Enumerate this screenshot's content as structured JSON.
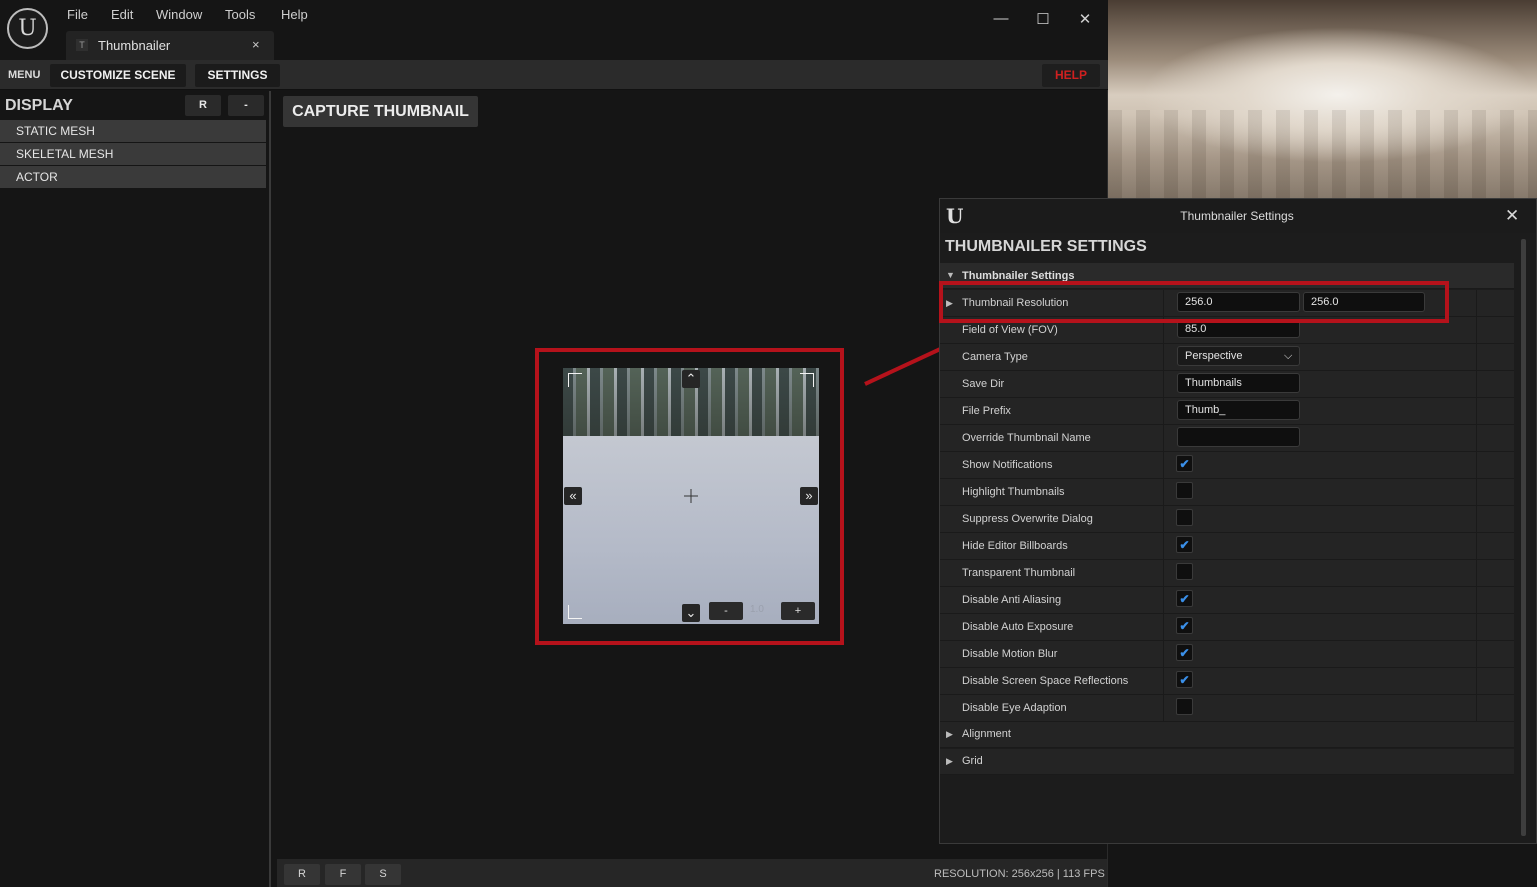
{
  "menubar": {
    "items": [
      "File",
      "Edit",
      "Window",
      "Tools",
      "Help"
    ]
  },
  "tab": {
    "label": "Thumbnailer",
    "icon_letter": "T",
    "close": "×"
  },
  "window_controls": {
    "minimize": "—",
    "maximize": "☐",
    "close": "✕"
  },
  "toolbar": {
    "menu_label": "MENU",
    "customize_scene": "CUSTOMIZE SCENE",
    "settings": "SETTINGS",
    "help": "HELP"
  },
  "left_panel": {
    "title": "DISPLAY",
    "reset_btn": "R",
    "collapse_btn": "-",
    "items": [
      "STATIC MESH",
      "SKELETAL MESH",
      "ACTOR"
    ]
  },
  "viewport": {
    "capture_button": "CAPTURE THUMBNAIL",
    "bottom_buttons": [
      "R",
      "F",
      "S"
    ],
    "status": "RESOLUTION: 256x256 | 113 FPS",
    "preview": {
      "zoom_minus": "-",
      "zoom_value": "1.0",
      "zoom_plus": "+",
      "up": "⌃",
      "down": "⌄",
      "left": "«",
      "right": "»"
    }
  },
  "settings_window": {
    "title": "Thumbnailer Settings",
    "header": "THUMBNAILER SETTINGS",
    "category": "Thumbnailer Settings",
    "resolution": {
      "label": "Thumbnail Resolution",
      "x": "256.0",
      "y": "256.0"
    },
    "fov": {
      "label": "Field of View (FOV)",
      "value": "85.0"
    },
    "camera_type": {
      "label": "Camera Type",
      "value": "Perspective"
    },
    "save_dir": {
      "label": "Save Dir",
      "value": "Thumbnails"
    },
    "file_prefix": {
      "label": "File Prefix",
      "value": "Thumb_"
    },
    "override_name": {
      "label": "Override Thumbnail Name",
      "value": ""
    },
    "checkboxes": [
      {
        "label": "Show Notifications",
        "checked": true
      },
      {
        "label": "Highlight Thumbnails",
        "checked": false
      },
      {
        "label": "Suppress Overwrite Dialog",
        "checked": false
      },
      {
        "label": "Hide Editor Billboards",
        "checked": true
      },
      {
        "label": "Transparent Thumbnail",
        "checked": false
      },
      {
        "label": "Disable Anti Aliasing",
        "checked": true
      },
      {
        "label": "Disable Auto Exposure",
        "checked": true
      },
      {
        "label": "Disable Motion Blur",
        "checked": true
      },
      {
        "label": "Disable Screen Space Reflections",
        "checked": true
      },
      {
        "label": "Disable Eye Adaption",
        "checked": false
      }
    ],
    "sub_categories": [
      "Alignment",
      "Grid"
    ]
  },
  "colors": {
    "highlight": "#b5121b",
    "check": "#3a8fe8",
    "help": "#d02020"
  }
}
